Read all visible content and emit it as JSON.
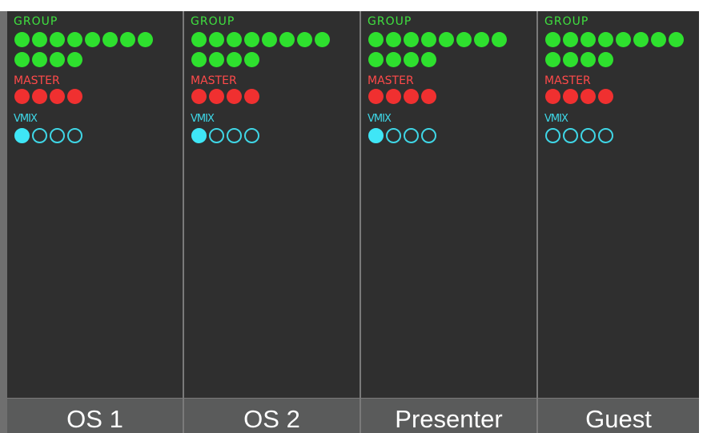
{
  "colors": {
    "group": "#2ee02e",
    "master": "#f03030",
    "vmix": "#3fe6f6",
    "panel": "#2f2f2f",
    "footer": "#5a5b5b"
  },
  "labels": {
    "group": "GROUP",
    "master": "MASTER",
    "vmix": "VMIX"
  },
  "channels": [
    {
      "name": "OS 1",
      "vmix_active": [
        true,
        false,
        false,
        false
      ]
    },
    {
      "name": "OS 2",
      "vmix_active": [
        true,
        false,
        false,
        false
      ]
    },
    {
      "name": "Presenter",
      "vmix_active": [
        true,
        false,
        false,
        false
      ]
    },
    {
      "name": "Guest",
      "vmix_active": [
        false,
        false,
        false,
        false
      ]
    }
  ],
  "group_count": 12,
  "master_count": 4
}
